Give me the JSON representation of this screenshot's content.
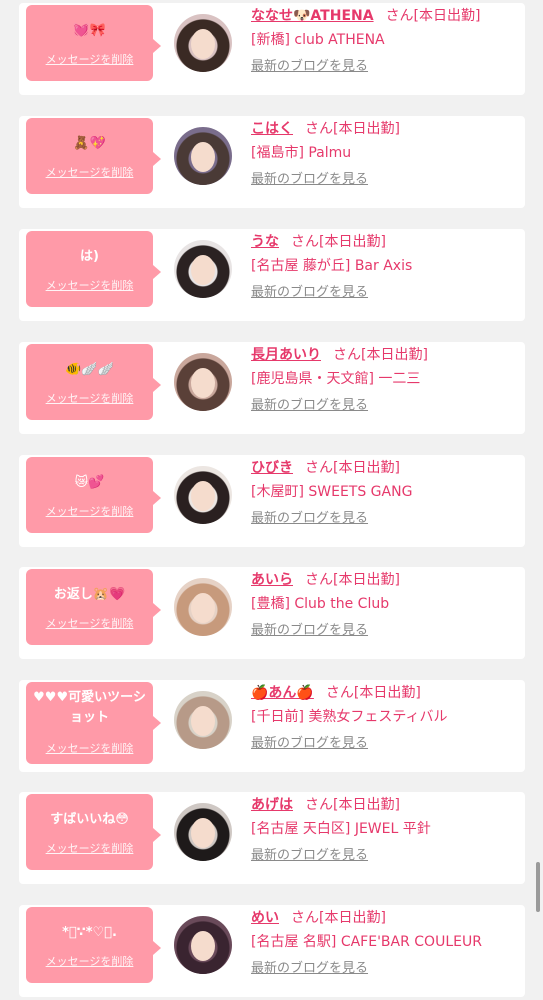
{
  "delete_label": "メッセージを削除",
  "blog_label": "最新のブログを見る",
  "colors": {
    "bubble": "#ff9aa8",
    "accent": "#e6396b",
    "link_gray": "#8a8a8a",
    "background": "#f1f1f1"
  },
  "cards": [
    {
      "message": "💓🎀",
      "name": "ななせ🐶ATHENA",
      "suffix": "さん[本日出勤]",
      "shop": "[新橋] club ATHENA",
      "avatar": {
        "hair": "#3a2a24",
        "bg": "#d9c2c2"
      }
    },
    {
      "message": "🧸💖",
      "name": "こはく",
      "suffix": "さん[本日出勤]",
      "shop": "[福島市] Palmu",
      "avatar": {
        "hair": "#4a3a36",
        "bg": "#7a6d8c"
      }
    },
    {
      "message": "は)",
      "name": "うな",
      "suffix": "さん[本日出勤]",
      "shop": "[名古屋 藤が丘] Bar Axis",
      "avatar": {
        "hair": "#2b2222",
        "bg": "#e8e4e4"
      }
    },
    {
      "message": "🐠🪽🪽",
      "name": "長月あいり",
      "suffix": "さん[本日出勤]",
      "shop": "[鹿児島県・天文館] 一二三",
      "avatar": {
        "hair": "#5a4038",
        "bg": "#c9a79c"
      }
    },
    {
      "message": "😿💕",
      "name": "ひびき",
      "suffix": "さん[本日出勤]",
      "shop": "[木屋町] SWEETS GANG",
      "avatar": {
        "hair": "#2a2020",
        "bg": "#ece6e2"
      }
    },
    {
      "message": "お返し🐹💗",
      "name": "あいら",
      "suffix": "さん[本日出勤]",
      "shop": "[豊橋] Club the Club",
      "avatar": {
        "hair": "#c79a7c",
        "bg": "#e6d2c6"
      }
    },
    {
      "message": "♥♥♥可愛いツーショット",
      "name": "🍎あん🍎",
      "suffix": "さん[本日出勤]",
      "shop": "[千日前] 美熟女フェスティバル",
      "avatar": {
        "hair": "#b79a88",
        "bg": "#d8d2c8"
      }
    },
    {
      "message": "すばいいね😳",
      "name": "あげは",
      "suffix": "さん[本日出勤]",
      "shop": "[名古屋 天白区] JEWEL 平針",
      "avatar": {
        "hair": "#1e1a1a",
        "bg": "#cfc8c4"
      }
    },
    {
      "message": "*ﾟ∵*♡ﾟ.",
      "name": "めい",
      "suffix": "さん[本日出勤]",
      "shop": "[名古屋 名駅] CAFE'BAR COULEUR",
      "avatar": {
        "hair": "#3a2430",
        "bg": "#6a4a5a"
      }
    }
  ]
}
